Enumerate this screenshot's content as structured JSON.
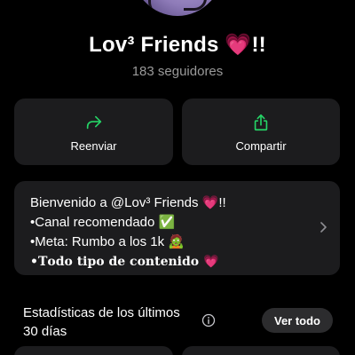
{
  "channel": {
    "name": "Lov³ Friends 💗!!",
    "followers": "183 seguidores"
  },
  "actions": {
    "forward_label": "Reenviar",
    "share_label": "Compartir"
  },
  "description": {
    "lines": [
      "Bienvenido a @Lov³ Friends 💗!!",
      "•Canal recomendado ✅",
      "•Meta: Rumbo a los 1k 🧟",
      "•𝐓𝐨𝐝𝐨 𝐭𝐢𝐩𝐨 𝐝𝐞 𝐜𝐨𝐧𝐭𝐞𝐧𝐢𝐝𝐨 💗"
    ]
  },
  "stats": {
    "title_line1": "Estadísticas de los últimos",
    "title_line2": "30 días",
    "see_all_label": "Ver todo"
  },
  "colors": {
    "background": "#000000",
    "card": "#1c1c1e",
    "accent_green": "#25d366",
    "muted_text": "#9a9a9a"
  }
}
